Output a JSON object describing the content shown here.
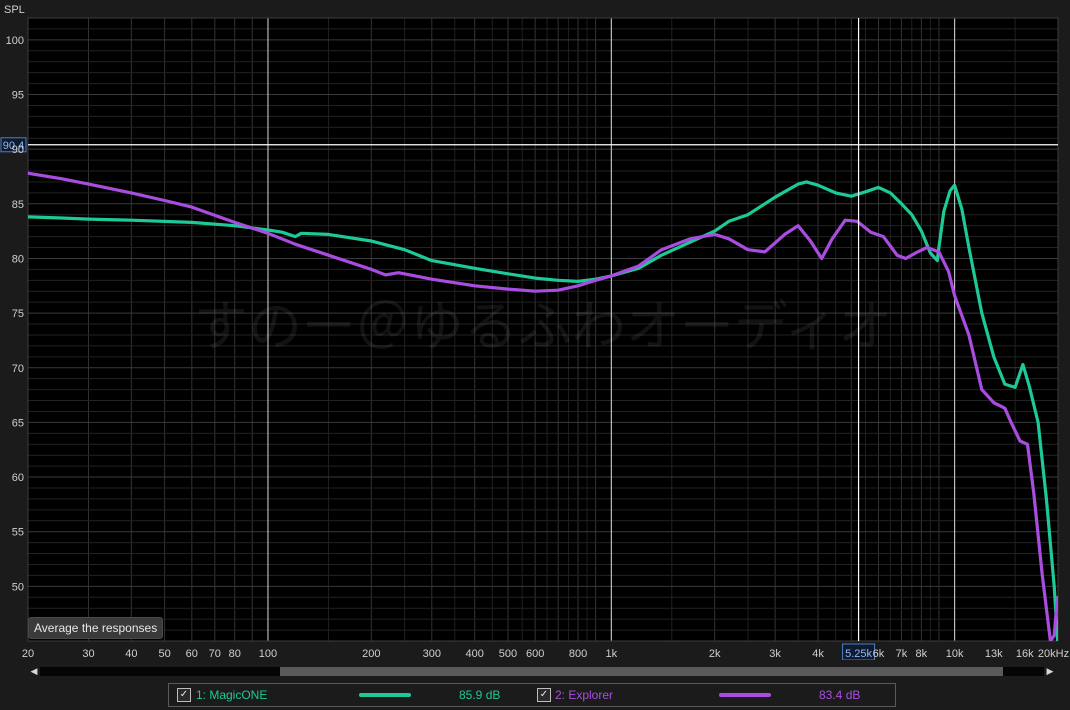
{
  "chart_data": {
    "type": "line",
    "ylabel": "SPL",
    "xscale": "log",
    "xlim": [
      20,
      20000
    ],
    "ylim": [
      45,
      102
    ],
    "y_ticks": [
      50,
      55,
      60,
      65,
      70,
      75,
      80,
      85,
      90,
      95,
      100
    ],
    "x_ticks": [
      {
        "value": 20,
        "label": "20"
      },
      {
        "value": 30,
        "label": "30"
      },
      {
        "value": 40,
        "label": "40"
      },
      {
        "value": 50,
        "label": "50"
      },
      {
        "value": 60,
        "label": "60"
      },
      {
        "value": 70,
        "label": "70"
      },
      {
        "value": 80,
        "label": "80"
      },
      {
        "value": 100,
        "label": "100"
      },
      {
        "value": 200,
        "label": "200"
      },
      {
        "value": 300,
        "label": "300"
      },
      {
        "value": 400,
        "label": "400"
      },
      {
        "value": 500,
        "label": "500"
      },
      {
        "value": 600,
        "label": "600"
      },
      {
        "value": 800,
        "label": "800"
      },
      {
        "value": 1000,
        "label": "1k"
      },
      {
        "value": 2000,
        "label": "2k"
      },
      {
        "value": 3000,
        "label": "3k"
      },
      {
        "value": 4000,
        "label": "4k"
      },
      {
        "value": 6000,
        "label": "6k"
      },
      {
        "value": 7000,
        "label": "7k"
      },
      {
        "value": 8000,
        "label": "8k"
      },
      {
        "value": 10000,
        "label": "10k"
      },
      {
        "value": 13000,
        "label": "13k"
      },
      {
        "value": 16000,
        "label": "16k"
      },
      {
        "value": 20000,
        "label": "20kHz"
      }
    ],
    "cursor": {
      "x": 5250,
      "x_label": "5.25k",
      "y": 90.4,
      "y_label": "90.4"
    },
    "grid": true,
    "watermark": "すのー＠ゆるふわオーディオ",
    "series": [
      {
        "name": "1: MagicONE",
        "color": "#1dc996",
        "level": "85.9 dB",
        "points": [
          [
            20,
            83.8
          ],
          [
            25,
            83.7
          ],
          [
            30,
            83.6
          ],
          [
            40,
            83.5
          ],
          [
            60,
            83.3
          ],
          [
            80,
            83.0
          ],
          [
            100,
            82.6
          ],
          [
            110,
            82.4
          ],
          [
            120,
            82.0
          ],
          [
            125,
            82.3
          ],
          [
            150,
            82.2
          ],
          [
            200,
            81.6
          ],
          [
            250,
            80.8
          ],
          [
            300,
            79.8
          ],
          [
            400,
            79.1
          ],
          [
            500,
            78.6
          ],
          [
            600,
            78.2
          ],
          [
            700,
            78.0
          ],
          [
            800,
            77.9
          ],
          [
            900,
            78.1
          ],
          [
            1000,
            78.4
          ],
          [
            1200,
            79.1
          ],
          [
            1400,
            80.3
          ],
          [
            1700,
            81.5
          ],
          [
            2000,
            82.5
          ],
          [
            2200,
            83.4
          ],
          [
            2500,
            84.0
          ],
          [
            3000,
            85.6
          ],
          [
            3500,
            86.8
          ],
          [
            3700,
            87.0
          ],
          [
            4000,
            86.7
          ],
          [
            4500,
            86.0
          ],
          [
            5000,
            85.7
          ],
          [
            5500,
            86.1
          ],
          [
            6000,
            86.5
          ],
          [
            6500,
            86.0
          ],
          [
            7000,
            85.0
          ],
          [
            7500,
            84.0
          ],
          [
            8000,
            82.5
          ],
          [
            8500,
            80.5
          ],
          [
            8900,
            79.8
          ],
          [
            9000,
            81.0
          ],
          [
            9300,
            84.3
          ],
          [
            9700,
            86.2
          ],
          [
            10000,
            86.7
          ],
          [
            10500,
            84.5
          ],
          [
            11000,
            81.0
          ],
          [
            12000,
            75.0
          ],
          [
            13000,
            71.0
          ],
          [
            14000,
            68.5
          ],
          [
            15000,
            68.2
          ],
          [
            15800,
            70.3
          ],
          [
            16500,
            68.3
          ],
          [
            17500,
            65.0
          ],
          [
            18500,
            58.0
          ],
          [
            19500,
            50.0
          ],
          [
            20000,
            44.5
          ]
        ]
      },
      {
        "name": "2: Explorer",
        "color": "#a94de0",
        "level": "83.4 dB",
        "points": [
          [
            20,
            87.8
          ],
          [
            25,
            87.3
          ],
          [
            30,
            86.8
          ],
          [
            40,
            86.0
          ],
          [
            50,
            85.3
          ],
          [
            60,
            84.7
          ],
          [
            80,
            83.3
          ],
          [
            100,
            82.3
          ],
          [
            120,
            81.3
          ],
          [
            150,
            80.3
          ],
          [
            200,
            79.0
          ],
          [
            220,
            78.5
          ],
          [
            240,
            78.7
          ],
          [
            300,
            78.1
          ],
          [
            400,
            77.5
          ],
          [
            500,
            77.2
          ],
          [
            600,
            77.0
          ],
          [
            700,
            77.1
          ],
          [
            800,
            77.5
          ],
          [
            900,
            78.0
          ],
          [
            1000,
            78.4
          ],
          [
            1200,
            79.3
          ],
          [
            1400,
            80.8
          ],
          [
            1700,
            81.8
          ],
          [
            2000,
            82.2
          ],
          [
            2200,
            81.8
          ],
          [
            2500,
            80.8
          ],
          [
            2800,
            80.6
          ],
          [
            3200,
            82.2
          ],
          [
            3500,
            83.0
          ],
          [
            3800,
            81.6
          ],
          [
            4100,
            80.0
          ],
          [
            4400,
            81.8
          ],
          [
            4800,
            83.5
          ],
          [
            5200,
            83.4
          ],
          [
            5700,
            82.4
          ],
          [
            6200,
            82.0
          ],
          [
            6800,
            80.3
          ],
          [
            7200,
            80.0
          ],
          [
            7800,
            80.6
          ],
          [
            8300,
            81.0
          ],
          [
            9000,
            80.6
          ],
          [
            9600,
            78.8
          ],
          [
            10000,
            76.6
          ],
          [
            11000,
            73.0
          ],
          [
            12000,
            68.0
          ],
          [
            13000,
            66.8
          ],
          [
            14000,
            66.3
          ],
          [
            14600,
            65.0
          ],
          [
            15500,
            63.3
          ],
          [
            16300,
            63.0
          ],
          [
            17000,
            58.5
          ],
          [
            18000,
            51.0
          ],
          [
            19000,
            45.0
          ],
          [
            19500,
            45.5
          ],
          [
            19800,
            48.0
          ],
          [
            20000,
            49.0
          ]
        ]
      }
    ]
  },
  "ui": {
    "avg_button": "Average the responses",
    "check_mark": "✓",
    "scroll_left": "◀",
    "scroll_right": "▶"
  }
}
